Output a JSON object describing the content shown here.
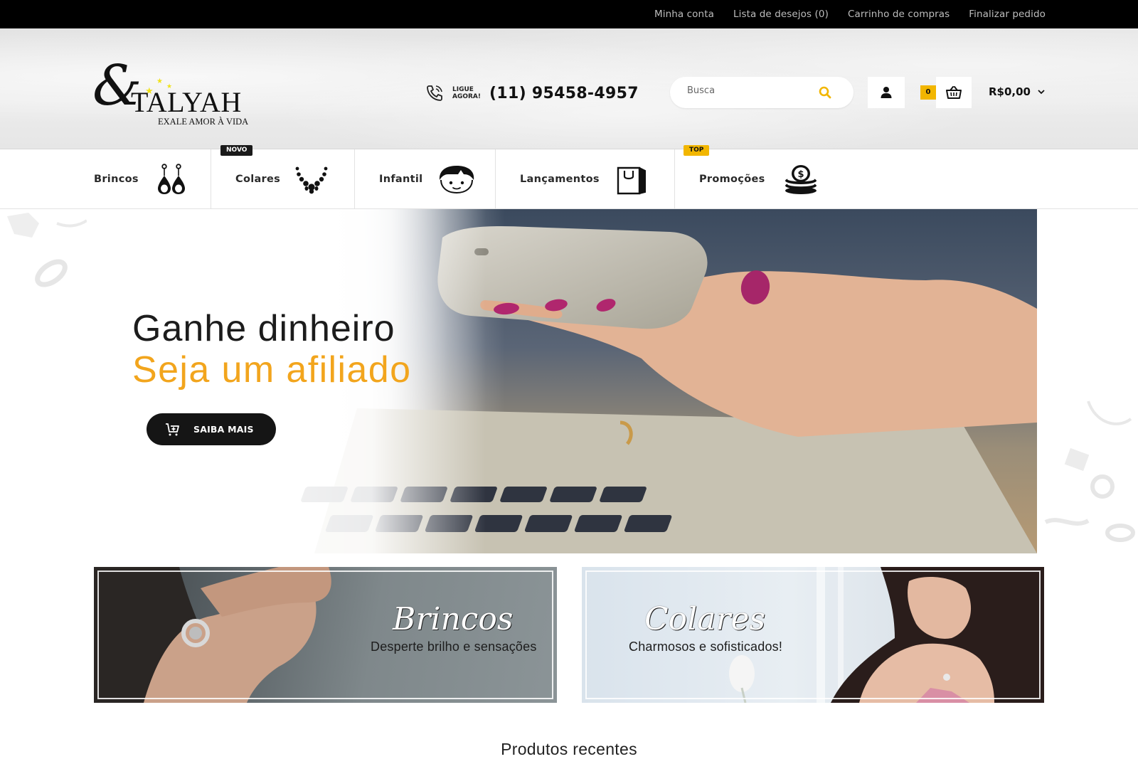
{
  "topbar": {
    "links": [
      "Minha conta",
      "Lista de desejos (0)",
      "Carrinho de compras",
      "Finalizar pedido"
    ]
  },
  "header": {
    "logo": {
      "name": "TALYAH",
      "tagline": "EXALE AMOR À VIDA"
    },
    "phone": {
      "prompt_line1": "LIGUE",
      "prompt_line2": "AGORA!",
      "number": "(11) 95458-4957"
    },
    "search": {
      "placeholder": "Busca"
    },
    "cart": {
      "count": "0",
      "total": "R$0,00"
    }
  },
  "categories": [
    {
      "label": "Brincos",
      "icon": "earrings-icon",
      "badge": ""
    },
    {
      "label": "Colares",
      "icon": "necklace-icon",
      "badge": "NOVO"
    },
    {
      "label": "Infantil",
      "icon": "child-face-icon",
      "badge": ""
    },
    {
      "label": "Lançamentos",
      "icon": "shopping-bag-icon",
      "badge": ""
    },
    {
      "label": "Promoções",
      "icon": "coins-icon",
      "badge": "TOP"
    }
  ],
  "hero": {
    "title": "Ganhe dinheiro",
    "subtitle": "Seja um afiliado",
    "button_label": "SAIBA MAIS"
  },
  "banners": [
    {
      "title": "Brincos",
      "subtitle": "Desperte brilho e sensações"
    },
    {
      "title": "Colares",
      "subtitle": "Charmosos e sofisticados!"
    }
  ],
  "sections": {
    "recent_title": "Produtos recentes"
  },
  "colors": {
    "accent": "#f2a51d",
    "badge_yellow": "#f2b600",
    "dark": "#151515"
  }
}
